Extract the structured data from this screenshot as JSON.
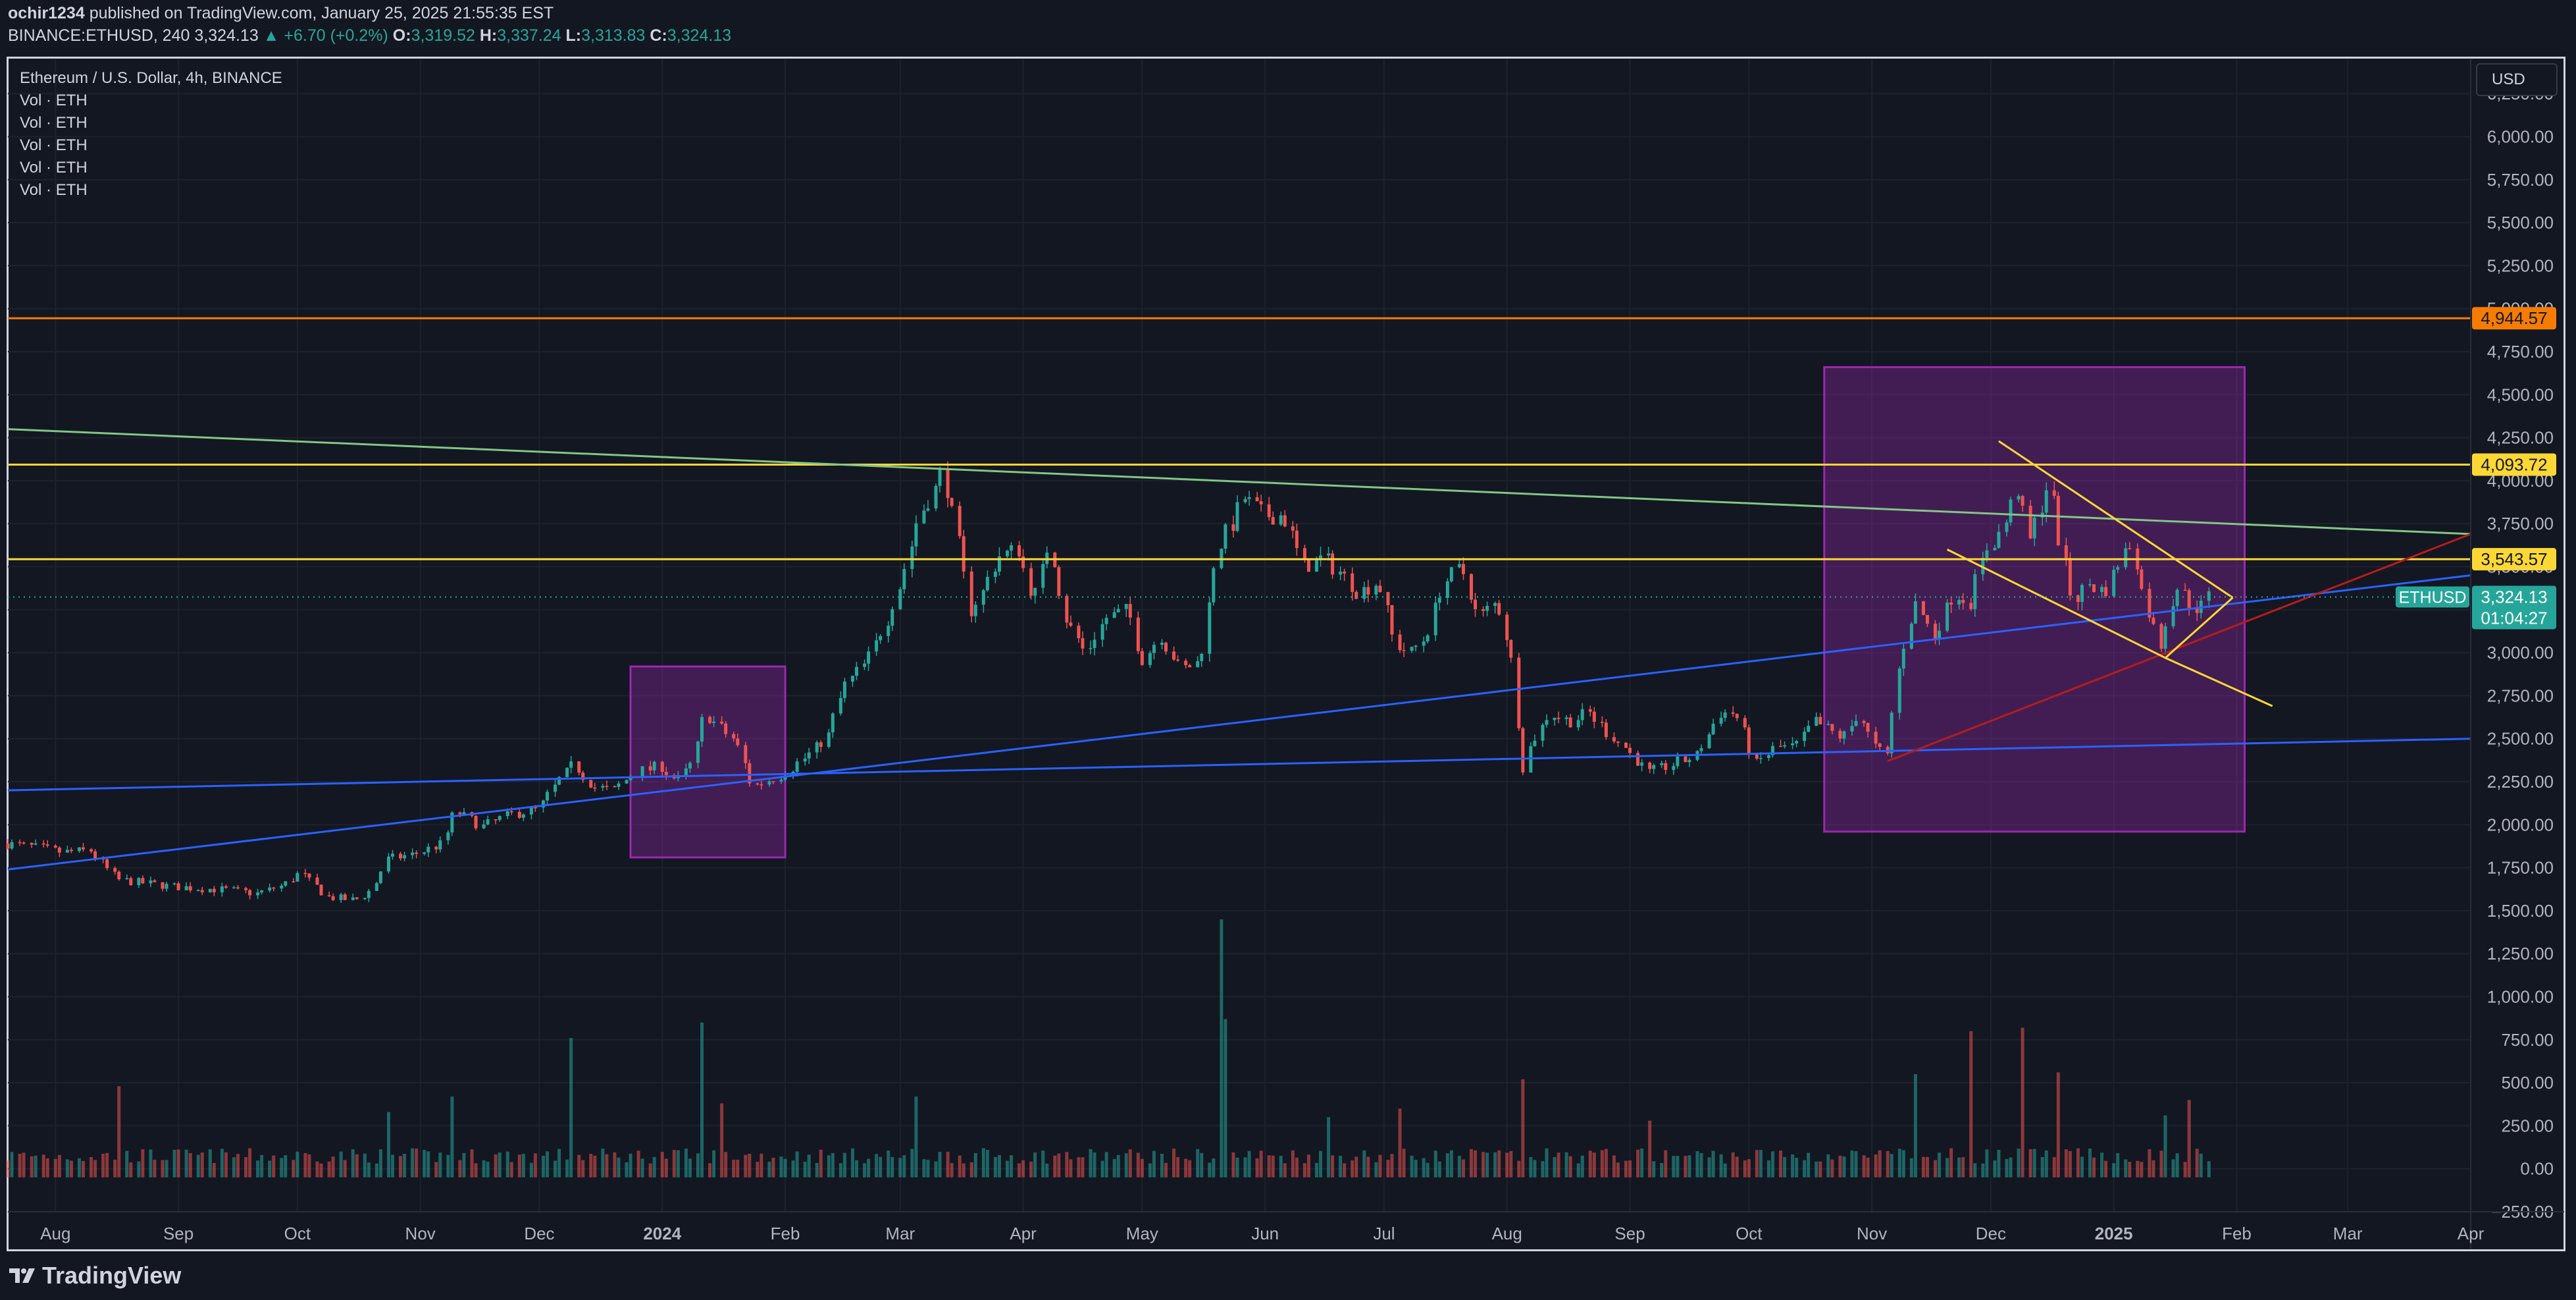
{
  "header": {
    "author": "ochir1234",
    "published_text": "published on TradingView.com, January 25, 2025 21:55:35 EST",
    "symbol_line": "BINANCE:ETHUSD, 240",
    "last": "3,324.13",
    "change": "▲ +6.70 (+0.2%)",
    "open_label": "O:",
    "open": "3,319.52",
    "high_label": "H:",
    "high": "3,337.24",
    "low_label": "L:",
    "low": "3,313.83",
    "close_label": "C:",
    "close": "3,324.13"
  },
  "legend": {
    "title": "Ethereum / U.S. Dollar, 4h, BINANCE",
    "indicators": [
      "Vol · ETH",
      "Vol · ETH",
      "Vol · ETH",
      "Vol · ETH",
      "Vol · ETH"
    ]
  },
  "currency_button": "USD",
  "footer": {
    "brand": "TradingView"
  },
  "colors": {
    "background": "#131722",
    "up": "#26a69a",
    "down": "#ef5350",
    "orange": "#f57c00",
    "yellow": "#fdd835",
    "green": "#81c784",
    "blue": "#2962ff",
    "purple": "#9c27b0",
    "red": "#b71c1c"
  },
  "chart_data": {
    "type": "candlestick",
    "symbol": "ETHUSD",
    "interval": "4h",
    "y_axis": {
      "min": -250,
      "max": 6450,
      "ticks": [
        6250,
        6000,
        5750,
        5500,
        5250,
        5000,
        4750,
        4500,
        4250,
        4000,
        3750,
        3500,
        3250,
        3000,
        2750,
        2500,
        2250,
        2000,
        1750,
        1500,
        1250,
        1000,
        750,
        500,
        250,
        0,
        -250
      ],
      "tick_labels": [
        "6,250.00",
        "6,000.00",
        "5,750.00",
        "5,500.00",
        "5,250.00",
        "5,000.00",
        "4,750.00",
        "4,500.00",
        "4,250.00",
        "4,000.00",
        "3,750.00",
        "3,500.00",
        "3,250.00",
        "3,000.00",
        "2,750.00",
        "2,500.00",
        "2,250.00",
        "2,000.00",
        "1,750.00",
        "1,500.00",
        "1,250.00",
        "1,000.00",
        "750.00",
        "500.00",
        "250.00",
        "0.00",
        "−250.00"
      ]
    },
    "x_axis": {
      "start": "2023-07-20",
      "end": "2025-04-01",
      "ticks": [
        {
          "date": "2023-08-01",
          "label": "Aug",
          "bold": false
        },
        {
          "date": "2023-09-01",
          "label": "Sep",
          "bold": false
        },
        {
          "date": "2023-10-01",
          "label": "Oct",
          "bold": false
        },
        {
          "date": "2023-11-01",
          "label": "Nov",
          "bold": false
        },
        {
          "date": "2023-12-01",
          "label": "Dec",
          "bold": false
        },
        {
          "date": "2024-01-01",
          "label": "2024",
          "bold": true
        },
        {
          "date": "2024-02-01",
          "label": "Feb",
          "bold": false
        },
        {
          "date": "2024-03-01",
          "label": "Mar",
          "bold": false
        },
        {
          "date": "2024-04-01",
          "label": "Apr",
          "bold": false
        },
        {
          "date": "2024-05-01",
          "label": "May",
          "bold": false
        },
        {
          "date": "2024-06-01",
          "label": "Jun",
          "bold": false
        },
        {
          "date": "2024-07-01",
          "label": "Jul",
          "bold": false
        },
        {
          "date": "2024-08-01",
          "label": "Aug",
          "bold": false
        },
        {
          "date": "2024-09-01",
          "label": "Sep",
          "bold": false
        },
        {
          "date": "2024-10-01",
          "label": "Oct",
          "bold": false
        },
        {
          "date": "2024-11-01",
          "label": "Nov",
          "bold": false
        },
        {
          "date": "2024-12-01",
          "label": "Dec",
          "bold": false
        },
        {
          "date": "2025-01-01",
          "label": "2025",
          "bold": true
        },
        {
          "date": "2025-02-01",
          "label": "Feb",
          "bold": false
        },
        {
          "date": "2025-03-01",
          "label": "Mar",
          "bold": false
        },
        {
          "date": "2025-04-01",
          "label": "Apr",
          "bold": false
        }
      ]
    },
    "price_series": [
      [
        "2023-07-20",
        1890
      ],
      [
        "2023-07-27",
        1870
      ],
      [
        "2023-08-03",
        1840
      ],
      [
        "2023-08-10",
        1850
      ],
      [
        "2023-08-17",
        1680
      ],
      [
        "2023-08-24",
        1660
      ],
      [
        "2023-08-31",
        1640
      ],
      [
        "2023-09-07",
        1630
      ],
      [
        "2023-09-14",
        1620
      ],
      [
        "2023-09-21",
        1600
      ],
      [
        "2023-09-28",
        1650
      ],
      [
        "2023-10-02",
        1720
      ],
      [
        "2023-10-09",
        1580
      ],
      [
        "2023-10-16",
        1560
      ],
      [
        "2023-10-20",
        1620
      ],
      [
        "2023-10-24",
        1800
      ],
      [
        "2023-10-31",
        1830
      ],
      [
        "2023-11-07",
        1890
      ],
      [
        "2023-11-10",
        2080
      ],
      [
        "2023-11-17",
        1990
      ],
      [
        "2023-11-24",
        2060
      ],
      [
        "2023-12-01",
        2090
      ],
      [
        "2023-12-06",
        2250
      ],
      [
        "2023-12-10",
        2350
      ],
      [
        "2023-12-15",
        2220
      ],
      [
        "2023-12-20",
        2200
      ],
      [
        "2023-12-25",
        2300
      ],
      [
        "2024-01-01",
        2340
      ],
      [
        "2024-01-05",
        2250
      ],
      [
        "2024-01-09",
        2360
      ],
      [
        "2024-01-12",
        2650
      ],
      [
        "2024-01-16",
        2560
      ],
      [
        "2024-01-20",
        2480
      ],
      [
        "2024-01-24",
        2220
      ],
      [
        "2024-01-28",
        2260
      ],
      [
        "2024-02-01",
        2300
      ],
      [
        "2024-02-08",
        2420
      ],
      [
        "2024-02-12",
        2520
      ],
      [
        "2024-02-16",
        2800
      ],
      [
        "2024-02-22",
        2950
      ],
      [
        "2024-02-27",
        3200
      ],
      [
        "2024-03-02",
        3450
      ],
      [
        "2024-03-06",
        3800
      ],
      [
        "2024-03-10",
        3950
      ],
      [
        "2024-03-12",
        4060
      ],
      [
        "2024-03-15",
        3750
      ],
      [
        "2024-03-19",
        3250
      ],
      [
        "2024-03-22",
        3350
      ],
      [
        "2024-03-26",
        3560
      ],
      [
        "2024-03-31",
        3600
      ],
      [
        "2024-04-04",
        3300
      ],
      [
        "2024-04-08",
        3650
      ],
      [
        "2024-04-12",
        3200
      ],
      [
        "2024-04-17",
        3000
      ],
      [
        "2024-04-22",
        3200
      ],
      [
        "2024-04-28",
        3250
      ],
      [
        "2024-05-01",
        2950
      ],
      [
        "2024-05-06",
        3100
      ],
      [
        "2024-05-11",
        2900
      ],
      [
        "2024-05-16",
        2950
      ],
      [
        "2024-05-20",
        3600
      ],
      [
        "2024-05-24",
        3750
      ],
      [
        "2024-05-27",
        3900
      ],
      [
        "2024-06-01",
        3800
      ],
      [
        "2024-06-06",
        3800
      ],
      [
        "2024-06-11",
        3500
      ],
      [
        "2024-06-16",
        3550
      ],
      [
        "2024-06-21",
        3450
      ],
      [
        "2024-06-25",
        3350
      ],
      [
        "2024-06-30",
        3420
      ],
      [
        "2024-07-04",
        3050
      ],
      [
        "2024-07-08",
        3000
      ],
      [
        "2024-07-12",
        3100
      ],
      [
        "2024-07-16",
        3400
      ],
      [
        "2024-07-21",
        3500
      ],
      [
        "2024-07-25",
        3200
      ],
      [
        "2024-07-30",
        3300
      ],
      [
        "2024-08-03",
        2900
      ],
      [
        "2024-08-05",
        2300
      ],
      [
        "2024-08-07",
        2450
      ],
      [
        "2024-08-12",
        2650
      ],
      [
        "2024-08-17",
        2600
      ],
      [
        "2024-08-22",
        2650
      ],
      [
        "2024-08-26",
        2550
      ],
      [
        "2024-08-31",
        2450
      ],
      [
        "2024-09-06",
        2300
      ],
      [
        "2024-09-12",
        2350
      ],
      [
        "2024-09-18",
        2400
      ],
      [
        "2024-09-24",
        2650
      ],
      [
        "2024-09-28",
        2650
      ],
      [
        "2024-10-03",
        2350
      ],
      [
        "2024-10-08",
        2450
      ],
      [
        "2024-10-13",
        2450
      ],
      [
        "2024-10-18",
        2600
      ],
      [
        "2024-10-25",
        2500
      ],
      [
        "2024-10-29",
        2650
      ],
      [
        "2024-11-02",
        2450
      ],
      [
        "2024-11-05",
        2400
      ],
      [
        "2024-11-08",
        2900
      ],
      [
        "2024-11-12",
        3300
      ],
      [
        "2024-11-17",
        3100
      ],
      [
        "2024-11-22",
        3350
      ],
      [
        "2024-11-26",
        3300
      ],
      [
        "2024-11-30",
        3600
      ],
      [
        "2024-12-04",
        3700
      ],
      [
        "2024-12-08",
        3950
      ],
      [
        "2024-12-11",
        3650
      ],
      [
        "2024-12-16",
        4000
      ],
      [
        "2024-12-19",
        3600
      ],
      [
        "2024-12-22",
        3300
      ],
      [
        "2024-12-26",
        3400
      ],
      [
        "2024-12-30",
        3350
      ],
      [
        "2025-01-03",
        3550
      ],
      [
        "2025-01-06",
        3650
      ],
      [
        "2025-01-09",
        3300
      ],
      [
        "2025-01-13",
        3050
      ],
      [
        "2025-01-17",
        3400
      ],
      [
        "2025-01-20",
        3300
      ],
      [
        "2025-01-23",
        3250
      ],
      [
        "2025-01-25",
        3324.13
      ]
    ],
    "volume_spikes": [
      [
        "2023-08-17",
        480
      ],
      [
        "2023-10-24",
        330
      ],
      [
        "2023-11-10",
        420
      ],
      [
        "2023-12-09",
        760
      ],
      [
        "2024-01-12",
        850
      ],
      [
        "2024-01-16",
        380
      ],
      [
        "2024-03-05",
        420
      ],
      [
        "2024-05-21",
        1450
      ],
      [
        "2024-05-23",
        870
      ],
      [
        "2024-06-17",
        300
      ],
      [
        "2024-07-05",
        350
      ],
      [
        "2024-08-05",
        1280
      ],
      [
        "2024-08-06",
        520
      ],
      [
        "2024-09-06",
        280
      ],
      [
        "2024-11-12",
        550
      ],
      [
        "2024-11-26",
        800
      ],
      [
        "2024-12-09",
        820
      ],
      [
        "2024-12-19",
        560
      ],
      [
        "2025-01-14",
        310
      ],
      [
        "2025-01-21",
        400
      ]
    ],
    "price_labels": [
      {
        "value": 4944.57,
        "label": "4,944.57",
        "color": "#f57c00"
      },
      {
        "value": 4093.72,
        "label": "4,093.72",
        "color": "#fdd835"
      },
      {
        "value": 3543.57,
        "label": "3,543.57",
        "color": "#fdd835"
      }
    ],
    "last_price": {
      "symbol": "ETHUSD",
      "value": 3324.13,
      "label": "3,324.13",
      "countdown": "01:04:27"
    },
    "drawings": {
      "horizontal_lines": [
        {
          "value": 4944.57,
          "color": "#f57c00"
        },
        {
          "value": 4093.72,
          "color": "#fdd835"
        },
        {
          "value": 3543.57,
          "color": "#fdd835"
        }
      ],
      "trend_lines": [
        {
          "color": "#81c784",
          "from": [
            "2023-07-20",
            4300
          ],
          "to": [
            "2025-04-01",
            3690
          ]
        },
        {
          "color": "#2962ff",
          "from": [
            "2023-07-20",
            1740
          ],
          "to": [
            "2025-04-01",
            3450
          ]
        },
        {
          "color": "#2962ff",
          "from": [
            "2023-07-20",
            2200
          ],
          "to": [
            "2025-04-01",
            2500
          ]
        },
        {
          "color": "#b71c1c",
          "from": [
            "2024-11-05",
            2370
          ],
          "to": [
            "2025-04-01",
            3690
          ]
        },
        {
          "color": "#fdd835",
          "from": [
            "2024-11-20",
            3600
          ],
          "to": [
            "2025-01-14",
            2970
          ]
        },
        {
          "color": "#fdd835",
          "from": [
            "2024-12-03",
            4230
          ],
          "to": [
            "2025-01-31",
            3320
          ]
        },
        {
          "color": "#fdd835",
          "from": [
            "2025-01-14",
            2970
          ],
          "to": [
            "2025-01-31",
            3320
          ]
        },
        {
          "color": "#fdd835",
          "from": [
            "2025-01-14",
            2970
          ],
          "to": [
            "2025-02-10",
            2690
          ]
        }
      ],
      "rectangles": [
        {
          "from": [
            "2023-12-24",
            2920
          ],
          "to": [
            "2024-02-01",
            1810
          ],
          "color": "#9c27b0"
        },
        {
          "from": [
            "2024-10-20",
            4660
          ],
          "to": [
            "2025-02-03",
            1960
          ],
          "color": "#9c27b0"
        }
      ]
    }
  }
}
